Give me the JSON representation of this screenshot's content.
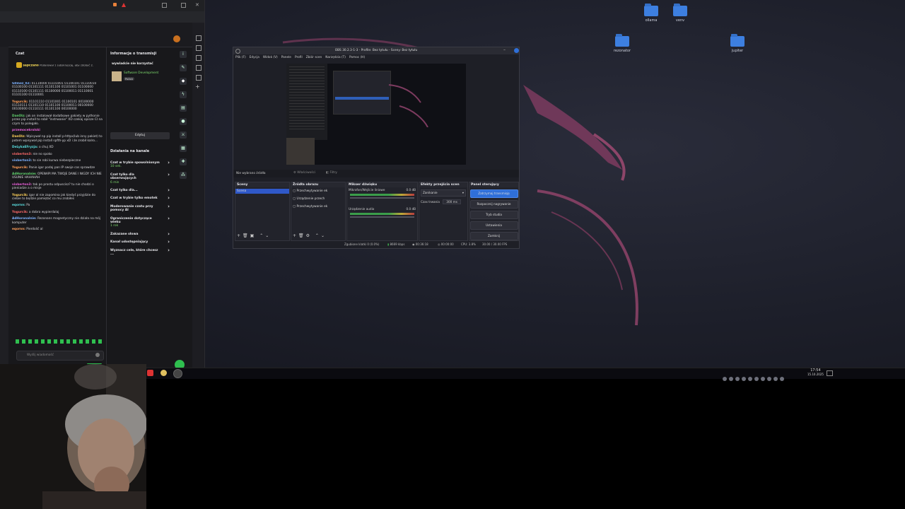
{
  "desktop": {
    "icons": [
      {
        "label": "ollama"
      },
      {
        "label": "venv"
      },
      {
        "label": "rezonator"
      },
      {
        "label": "jupiter"
      }
    ]
  },
  "browser": {
    "chat": {
      "title": "Czat",
      "pinned_user": "sapczano",
      "pinned_text": "Podarował 1 subskrypcję, aby zdobyć 2.",
      "messages": [
        {
          "user": "G0mez_02:",
          "text": "01110000 01101001 01100101 01110010 01100100 01101111 01101100 01101001 01100000 01110100 01101111 01100000 01100011 01110001 01101100 01110001"
        },
        {
          "user": "Yogurcik:",
          "text": "01101110 01101001 01100101 00100000 01110111 01101110 01101100 01100011 00100000 00100000 01110111 01101100 00100000"
        },
        {
          "user": "DanOlz:",
          "text": "jak on instalował dodatkowe pakiety w pythonie przez pip install to robił \"instrwanie\" XD czekaj opisze CI na czym to polegało."
        },
        {
          "user": "przemocekrolski",
          "text": ""
        },
        {
          "user": "DanOlz:",
          "text": "Wpisywał np pip install p-httpx(lub inny pakiet) to potem wpisywał pip install spfth-yp xD i że zrobił kalro..."
        },
        {
          "user": "DeLykaEFryzja:",
          "text": "o chuj XD"
        },
        {
          "user": "vioberton3:",
          "text": "nie no spoko"
        },
        {
          "user": "vioberton3:",
          "text": "to sie robi kurwa niebezpieczne"
        },
        {
          "user": "Yogurcik:",
          "text": "Panie igor podaj pan IP swoje cos sprawdze"
        },
        {
          "user": "AdHoronalnie:",
          "text": "OPENAPI MA TWOJE DANE I NIGDY ICH NIE USUNIE HAHAHAH"
        },
        {
          "user": "vioberton3:",
          "text": "tak po prostu odpuscisz? tu nie chodzi o pieniadze a o misje"
        },
        {
          "user": "Yogurcik:",
          "text": "igor al nie zapomina jak kiedyś przyjdzie do ciebie to będzie pamiętać co mu zrobiłes"
        },
        {
          "user": "eqornn:",
          "text": "Pa"
        },
        {
          "user": "Yogurcik:",
          "text": "a dobra wypierdalaj"
        },
        {
          "user": "AdHoronalnie:",
          "text": "Rezonans magnetyczny nie działa na mój komputer"
        },
        {
          "user": "eqornn:",
          "text": "Pierdolić al"
        }
      ],
      "input_placeholder": "Wyślij wiadomość"
    },
    "stream_info": {
      "title": "Informacje o transmisji",
      "status": "wywiadcie nie korzystać",
      "category": "Software Development",
      "language": "Polish",
      "edit_button": "Edytuj"
    },
    "channel_actions": {
      "title": "Działania na kanale",
      "items": [
        {
          "label": "Czat w trybie spowolnionym",
          "sub": "10 sek."
        },
        {
          "label": "Czat tylko dla obserwujących",
          "sub": "6 min"
        },
        {
          "label": "Czat tylko dla...",
          "sub": ""
        },
        {
          "label": "Czat w trybie tylko emotek",
          "sub": ""
        },
        {
          "label": "Moderowanie czatu przy pomocy AI",
          "sub": ""
        },
        {
          "label": "Ograniczenie dotyczące wieku",
          "sub": "1 rok"
        },
        {
          "label": "Zakazane słowa",
          "sub": ""
        },
        {
          "label": "Kanał udostępniający",
          "sub": ""
        },
        {
          "label": "Wyznacz cele, które chcesz ...",
          "sub": ""
        }
      ]
    }
  },
  "obs": {
    "window_title": "OBS 30.2.3-1-3 - Profile: Bez tytułu - Sceny: Bez tytułu",
    "menu": [
      "Plik (F)",
      "Edycja",
      "Widok (V)",
      "Panele",
      "Profil",
      "Zbiór scen",
      "Narzędzia (T)",
      "Pomoc (H)"
    ],
    "no_source": "Nie wybrano źródła",
    "properties_btn": "Właściwości",
    "filters_btn": "Filtry",
    "scenes": {
      "title": "Sceny",
      "items": [
        "Scena"
      ]
    },
    "sources": {
      "title": "Źródła obrazu",
      "items": [
        "Przechwytywanie ek",
        "Urządzenie przech",
        "Przechwytywanie ek"
      ]
    },
    "mixer": {
      "title": "Mikser dźwięku",
      "channels": [
        {
          "name": "Mikrofon/Wejście liniowe",
          "db": "0.0 dB"
        },
        {
          "name": "Urządzenie audio",
          "db": "0.0 dB"
        }
      ]
    },
    "transitions": {
      "title": "Efekty przejścia scen",
      "type": "Zanikanie",
      "duration_label": "Czas trwania",
      "duration": "300 ms"
    },
    "controls": {
      "title": "Panel sterujący",
      "buttons": [
        "Zatrzymaj transmisję",
        "Rozpocznij nagrywanie",
        "Tryb studia",
        "Ustawienia",
        "Zamknij"
      ]
    },
    "status": {
      "dropped": "Zgubione klatki 0 (0.0%)",
      "bitrate": "8669 kbps",
      "stream_time": "00:36:18",
      "rec_time": "00:00:00",
      "cpu": "CPU: 3.8%",
      "fps": "30.00 / 30.00 FPS"
    }
  },
  "taskbar": {
    "time": "17:54",
    "date": "15.10.2025"
  }
}
